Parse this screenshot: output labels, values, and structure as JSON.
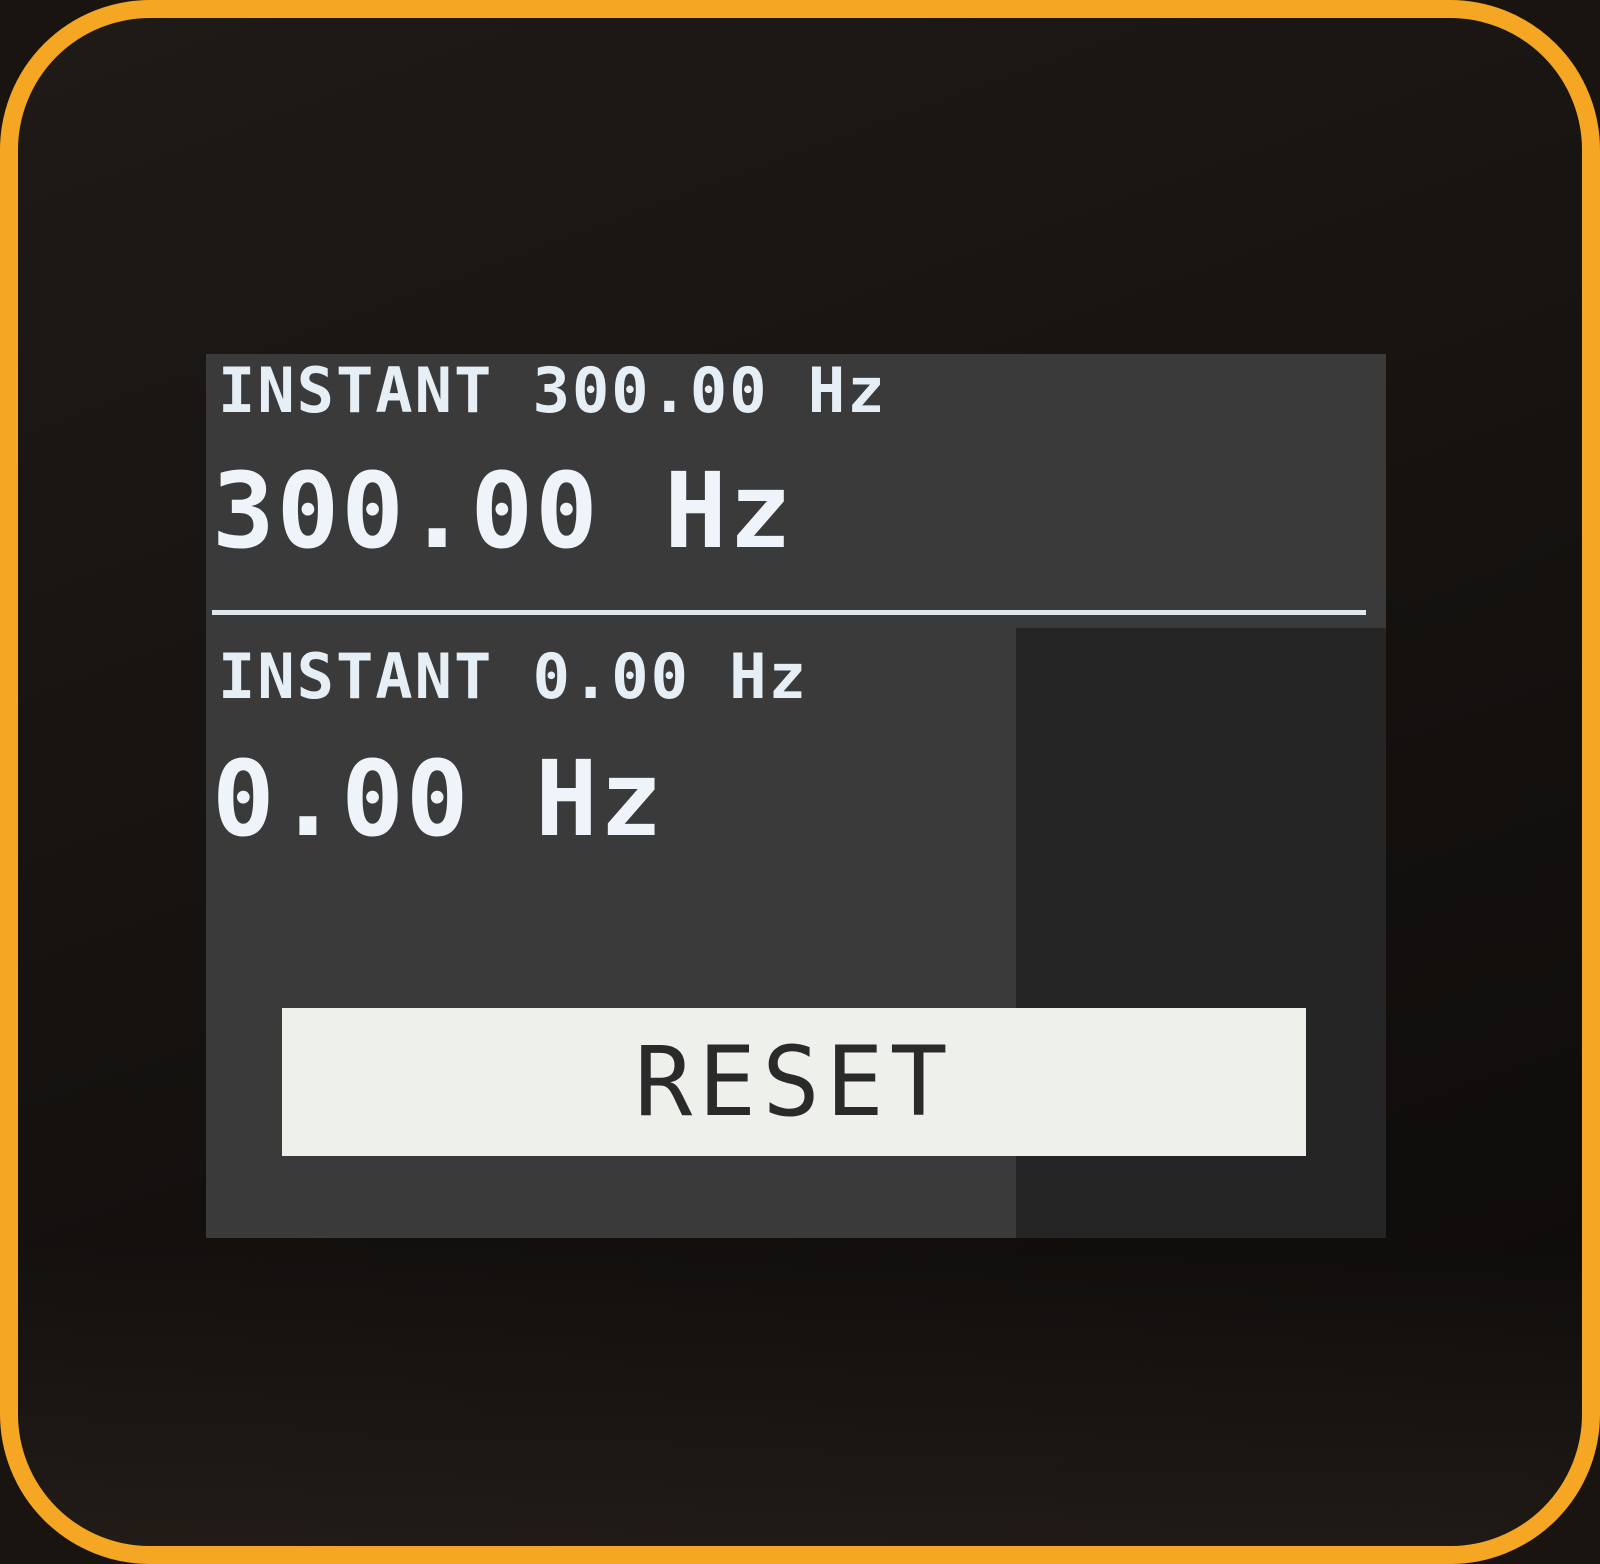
{
  "channel1": {
    "instant_label": "INSTANT 300.00 Hz",
    "value": "300.00 Hz"
  },
  "channel2": {
    "instant_label": "INSTANT 0.00 Hz",
    "value": "0.00 Hz"
  },
  "reset_button": {
    "label": "RESET"
  },
  "colors": {
    "device_bezel": "#f5a623",
    "screen_background": "#3a3a3a",
    "text": "#eef4fa",
    "button_background": "#eef0ec",
    "button_text": "#2a2a2a"
  }
}
